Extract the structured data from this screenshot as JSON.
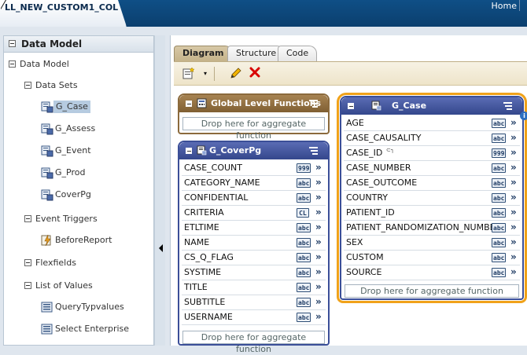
{
  "header": {
    "title": "LL_NEW_CUSTOM1_COL",
    "home_link": "Home"
  },
  "left_panel": {
    "title": "Data Model",
    "tree": {
      "root": "Data Model",
      "data_sets": "Data Sets",
      "data_set_items": [
        "G_Case",
        "G_Assess",
        "G_Event",
        "G_Prod",
        "CoverPg"
      ],
      "event_triggers": "Event Triggers",
      "trigger_items": [
        "BeforeReport"
      ],
      "flexfields": "Flexfields",
      "list_of_values": "List of Values",
      "lov_items": [
        "QueryTypvalues",
        "Select Enterprise"
      ]
    }
  },
  "main": {
    "tabs": [
      "Diagram",
      "Structure",
      "Code"
    ],
    "active_tab": "Diagram",
    "toolbar": {
      "new_icon": "new-dataset-icon",
      "edit_icon": "pencil-icon",
      "delete_icon": "delete-x-icon"
    }
  },
  "boxes": {
    "global": {
      "title": "Global Level Functions",
      "drop_text": "Drop here for aggregate function"
    },
    "coverpg": {
      "title": "G_CoverPg",
      "drop_text": "Drop here for aggregate function",
      "fields": [
        {
          "name": "CASE_COUNT",
          "type": "999"
        },
        {
          "name": "CATEGORY_NAME",
          "type": "abc"
        },
        {
          "name": "CONFIDENTIAL",
          "type": "abc"
        },
        {
          "name": "CRITERIA",
          "type": "CL"
        },
        {
          "name": "ETLTIME",
          "type": "abc"
        },
        {
          "name": "NAME",
          "type": "abc"
        },
        {
          "name": "CS_Q_FLAG",
          "type": "abc"
        },
        {
          "name": "SYSTIME",
          "type": "abc"
        },
        {
          "name": "TITLE",
          "type": "abc"
        },
        {
          "name": "SUBTITLE",
          "type": "abc"
        },
        {
          "name": "USERNAME",
          "type": "abc"
        }
      ]
    },
    "gcase": {
      "title": "G_Case",
      "drop_text": "Drop here for aggregate function",
      "fields": [
        {
          "name": "AGE",
          "type": "abc"
        },
        {
          "name": "CASE_CAUSALITY",
          "type": "abc"
        },
        {
          "name": "CASE_ID",
          "type": "999"
        },
        {
          "name": "CASE_NUMBER",
          "type": "abc"
        },
        {
          "name": "CASE_OUTCOME",
          "type": "abc"
        },
        {
          "name": "COUNTRY",
          "type": "abc"
        },
        {
          "name": "PATIENT_ID",
          "type": "abc"
        },
        {
          "name": "PATIENT_RANDOMIZATION_NUMBER",
          "type": "abc"
        },
        {
          "name": "SEX",
          "type": "abc"
        },
        {
          "name": "CUSTOM",
          "type": "abc"
        },
        {
          "name": "SOURCE",
          "type": "abc"
        }
      ]
    }
  },
  "colors": {
    "header_blue": "#0f4f86",
    "box_header_blue": "#3b4f98",
    "global_header_brown": "#8b6a3c",
    "selection_orange": "#f0a21a"
  }
}
